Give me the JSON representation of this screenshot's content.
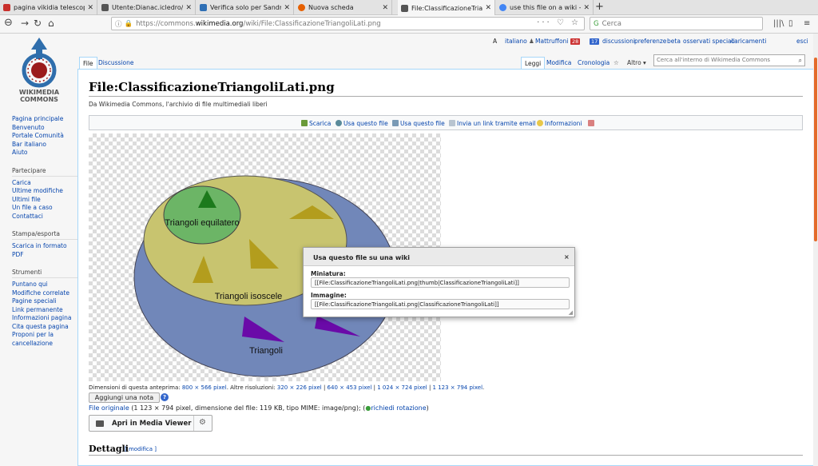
{
  "browser": {
    "tabs": [
      {
        "label": "pagina vikidia telescopi",
        "color": "#c9302c"
      },
      {
        "label": "Utente:Dianac.icledro/Sa",
        "color": "#555555"
      },
      {
        "label": "Verifica solo per Sandra",
        "color": "#2f6fb5"
      },
      {
        "label": "Nuova scheda",
        "color": "#e66000"
      },
      {
        "label": "File:ClassificazioneTriang",
        "color": "#555555"
      },
      {
        "label": "use this file on a wiki - Go",
        "color": "#4285f4"
      }
    ],
    "new_tab": "+",
    "url_prefix": "https://commons.",
    "url_domain": "wikimedia.org",
    "url_path": "/wiki/File:ClassificazioneTriangoliLati.png",
    "url_tail": "··· ♡ ☆",
    "search_placeholder": "Cerca"
  },
  "logo": {
    "line1": "WIKIMEDIA",
    "line2": "COMMONS"
  },
  "personal": {
    "language": "italiano",
    "user": "Mattruffoni",
    "alerts_count": "28",
    "notices_count": "17",
    "links": [
      "discussioni",
      "preferenze",
      "beta",
      "osservati speciali",
      "caricamenti",
      "esci"
    ]
  },
  "page_tabs": {
    "left": [
      "File",
      "Discussione"
    ],
    "right": [
      "Leggi",
      "Modifica",
      "Cronologia"
    ],
    "altro": "Altro ▾",
    "star": "☆"
  },
  "wiki_search_placeholder": "Cerca all'interno di Wikimedia Commons",
  "sidebar": {
    "nav": [
      "Pagina principale",
      "Benvenuto",
      "Portale Comunità",
      "Bar italiano",
      "Aiuto"
    ],
    "sections": [
      {
        "title": "Partecipare",
        "links": [
          "Carica",
          "Ultime modifiche",
          "Ultimi file",
          "Un file a caso",
          "Contattaci"
        ]
      },
      {
        "title": "Stampa/esporta",
        "links": [
          "Scarica in formato PDF"
        ]
      },
      {
        "title": "Strumenti",
        "links": [
          "Puntano qui",
          "Modifiche correlate",
          "Pagine speciali",
          "Link permanente",
          "Informazioni pagina",
          "Cita questa pagina",
          "Proponi per la cancellazione"
        ]
      }
    ]
  },
  "page": {
    "title": "File:ClassificazioneTriangoliLati.png",
    "tagline": "Da Wikimedia Commons, l'archivio di file multimediali liberi",
    "actions": [
      "Scarica",
      "Usa questo file",
      "Usa questo file",
      "Invia un link tramite email",
      "Informazioni"
    ],
    "image_labels": {
      "equilatero": "Triangoli equilatero",
      "isoscele": "Triangoli isoscele",
      "scaleni": "Triangoli"
    },
    "preview_prefix": "Dimensioni di questa anteprima:",
    "preview_size": "800 × 566 pixel",
    "other_prefix": ". Altre risoluzioni:",
    "resolutions": [
      "320 × 226 pixel",
      "640 × 453 pixel",
      "1 024 × 724 pixel",
      "1 123 × 794 pixel"
    ],
    "add_note": "Aggiungi una nota",
    "original_link": "File originale",
    "original_info": "(1 123 × 794 pixel, dimensione del file: 119 KB, tipo MIME: image/png); (",
    "rotate_link": "richiedi rotazione",
    "rotate_close": ")",
    "media_viewer": "Apri in Media Viewer",
    "details_heading": "Dettagli",
    "details_edit": "[ modifica ]"
  },
  "dialog": {
    "title": "Usa questo file su una wiki",
    "close": "×",
    "thumb_label": "Miniatura:",
    "thumb_code": "[[File:ClassificazioneTriangoliLati.png|thumb|ClassificazioneTriangoliLati]]",
    "image_label": "Immagine:",
    "image_code": "[[File:ClassificazioneTriangoliLati.png|ClassificazioneTriangoliLati]]"
  }
}
